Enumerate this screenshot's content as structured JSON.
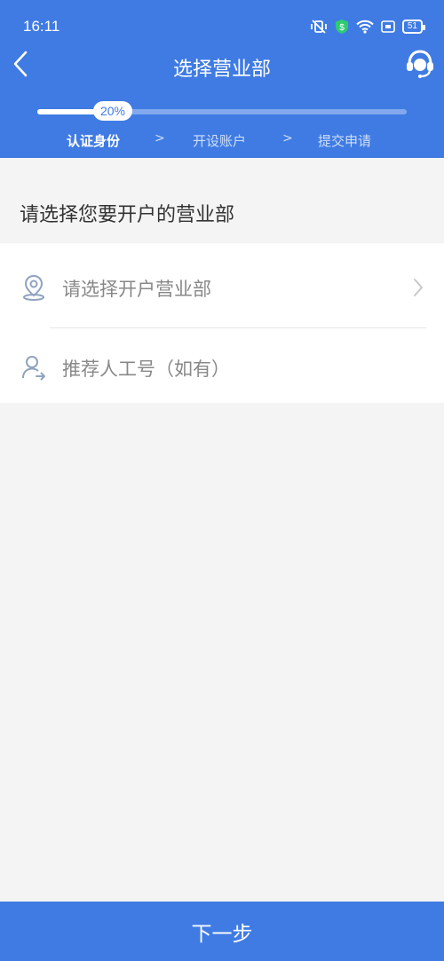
{
  "status_bar": {
    "time": "16:11",
    "battery": "51"
  },
  "nav": {
    "title": "选择营业部"
  },
  "progress": {
    "value": 0.2,
    "label": "20%"
  },
  "steps": [
    {
      "label": "认证身份",
      "active": true
    },
    {
      "label": "开设账户",
      "active": false
    },
    {
      "label": "提交申请",
      "active": false
    }
  ],
  "step_separator": ">",
  "section": {
    "title": "请选择您要开户的营业部"
  },
  "form": {
    "branch_placeholder": "请选择开户营业部",
    "referrer_placeholder": "推荐人工号（如有）"
  },
  "footer": {
    "next_label": "下一步"
  },
  "colors": {
    "primary": "#3f7be3",
    "background": "#f4f4f4",
    "placeholder": "#888888",
    "icon": "#8fa3c0"
  },
  "icons": {
    "back": "chevron-left-icon",
    "service": "headset-icon",
    "location": "location-pin-icon",
    "person": "person-arrow-icon",
    "chevron": "chevron-right-icon"
  }
}
